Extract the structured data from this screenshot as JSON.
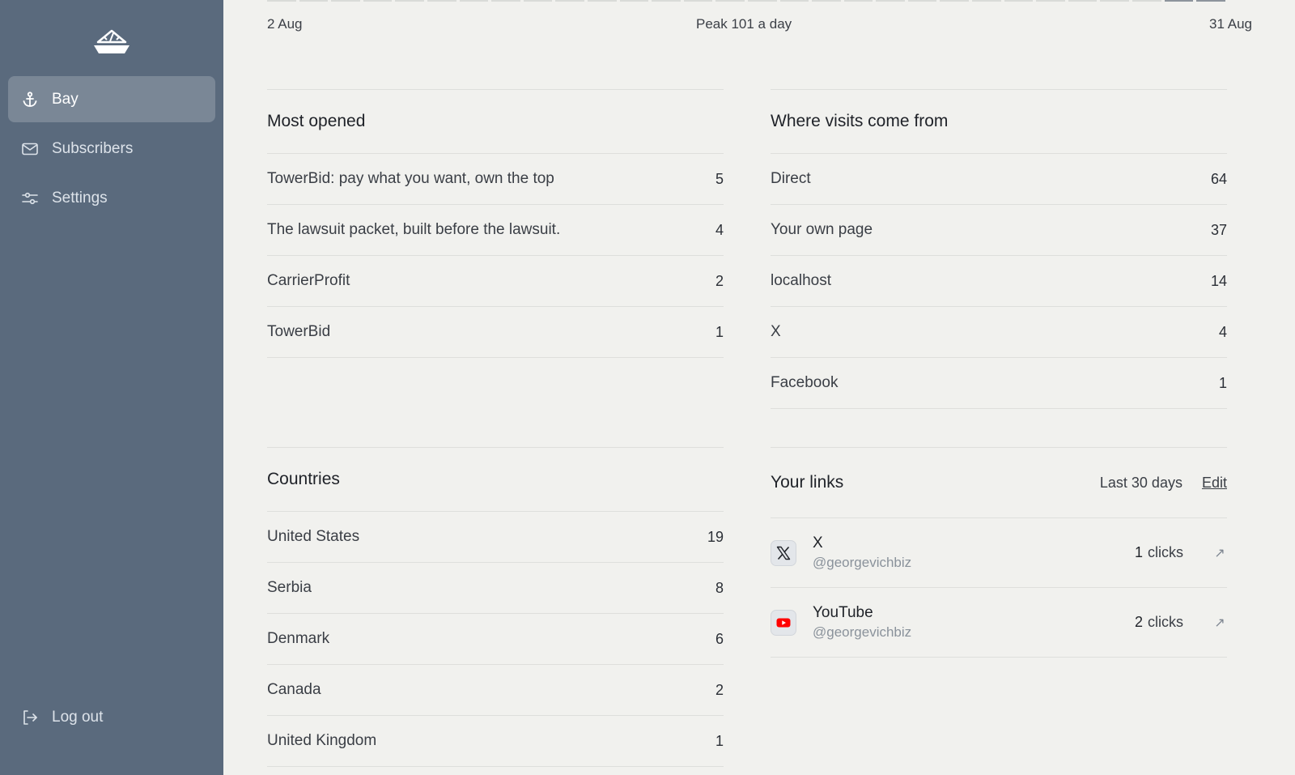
{
  "sidebar": {
    "logo_icon": "ship-code-logo",
    "items": [
      {
        "label": "Bay",
        "icon": "anchor-icon",
        "active": true
      },
      {
        "label": "Subscribers",
        "icon": "mail-icon",
        "active": false
      },
      {
        "label": "Settings",
        "icon": "sliders-icon",
        "active": false
      }
    ],
    "logout_label": "Log out"
  },
  "chart_footer": {
    "start_date": "2 Aug",
    "peak": "Peak 101 a day",
    "end_date": "31 Aug"
  },
  "most_opened": {
    "title": "Most opened",
    "rows": [
      {
        "label": "TowerBid: pay what you want, own the top",
        "value": "5"
      },
      {
        "label": "The lawsuit packet, built before the lawsuit.",
        "value": "4"
      },
      {
        "label": "CarrierProfit",
        "value": "2"
      },
      {
        "label": "TowerBid",
        "value": "1"
      }
    ]
  },
  "visits": {
    "title": "Where visits come from",
    "rows": [
      {
        "label": "Direct",
        "value": "64"
      },
      {
        "label": "Your own page",
        "value": "37"
      },
      {
        "label": "localhost",
        "value": "14"
      },
      {
        "label": "X",
        "value": "4"
      },
      {
        "label": "Facebook",
        "value": "1"
      }
    ]
  },
  "countries": {
    "title": "Countries",
    "rows": [
      {
        "label": "United States",
        "value": "19"
      },
      {
        "label": "Serbia",
        "value": "8"
      },
      {
        "label": "Denmark",
        "value": "6"
      },
      {
        "label": "Canada",
        "value": "2"
      },
      {
        "label": "United Kingdom",
        "value": "1"
      }
    ]
  },
  "links": {
    "title": "Your links",
    "period": "Last 30 days",
    "edit_label": "Edit",
    "items": [
      {
        "name": "X",
        "handle": "@georgevichbiz",
        "clicks": "1",
        "clicks_label": "clicks",
        "icon": "x-logo-icon",
        "arrow": "↗"
      },
      {
        "name": "YouTube",
        "handle": "@georgevichbiz",
        "clicks": "2",
        "clicks_label": "clicks",
        "icon": "youtube-icon",
        "arrow": "↗"
      }
    ]
  },
  "colors": {
    "sidebar_bg": "#5a6a7d",
    "sidebar_active": "#7a8796",
    "page_bg": "#f1f1ee",
    "youtube_red": "#ff0000"
  }
}
